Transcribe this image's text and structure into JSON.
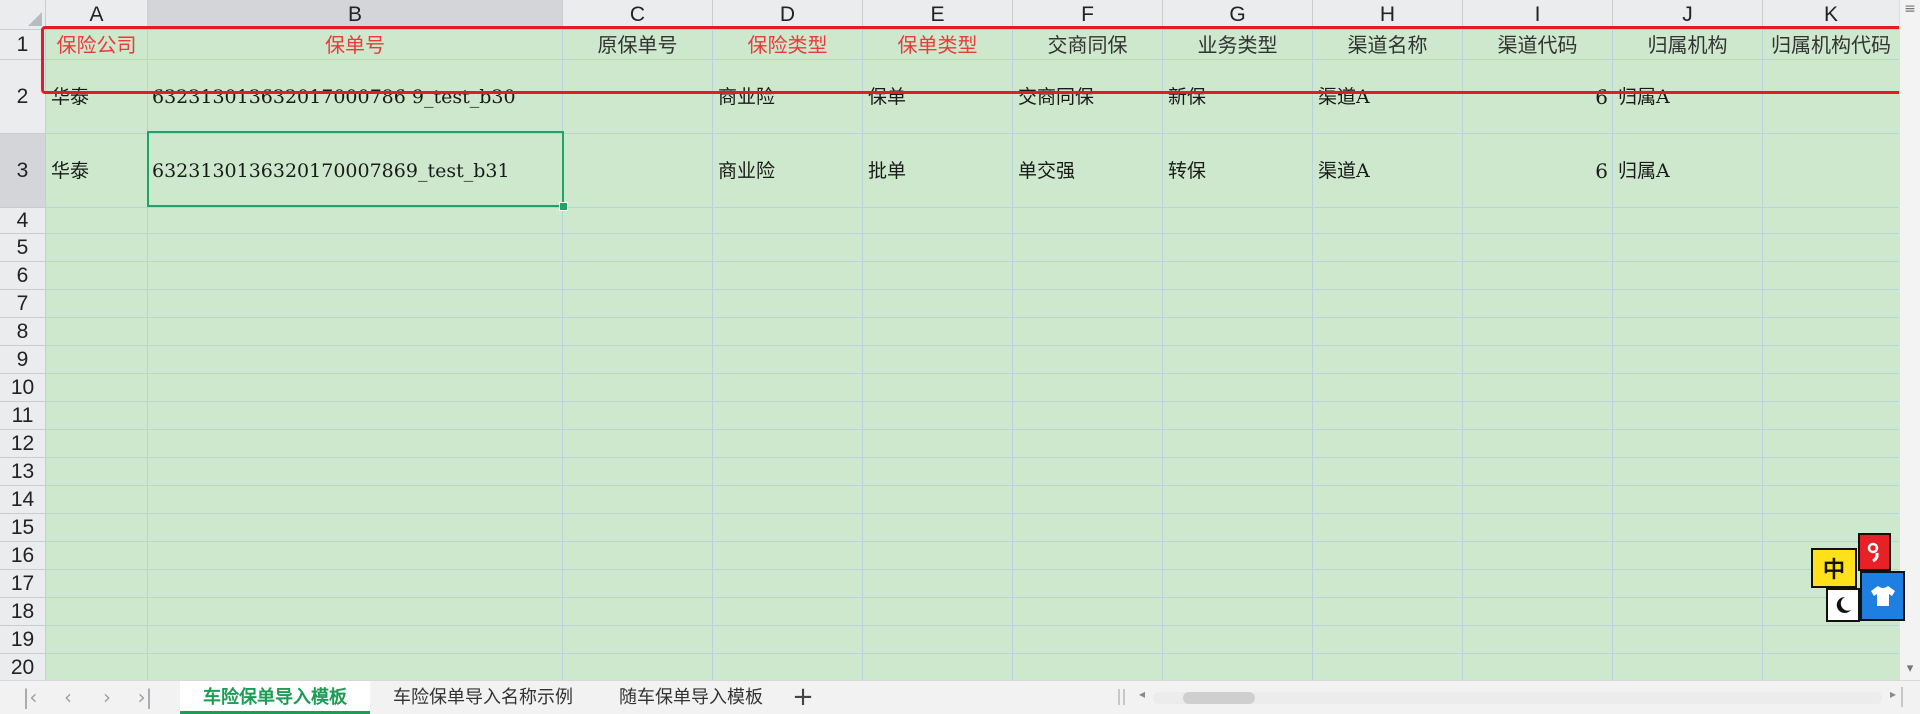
{
  "columns": [
    "A",
    "B",
    "C",
    "D",
    "E",
    "F",
    "G",
    "H",
    "I",
    "J",
    "K"
  ],
  "rows": [
    "1",
    "2",
    "3",
    "4",
    "5",
    "6",
    "7",
    "8",
    "9",
    "10",
    "11",
    "12",
    "13",
    "14",
    "15",
    "16",
    "17",
    "18",
    "19",
    "20"
  ],
  "header_cells": [
    "保险公司",
    "保单号",
    "原保单号",
    "保险类型",
    "保单类型",
    "交商同保",
    "业务类型",
    "渠道名称",
    "渠道代码",
    "归属机构",
    "归属机构代码"
  ],
  "data_rows": [
    [
      "华泰",
      "632313013632017000786 9_test_b30",
      "",
      "商业险",
      "保单",
      "交商同保",
      "新保",
      "渠道A",
      "6",
      "归属A",
      ""
    ],
    [
      "华泰",
      "6323130136320170007869_test_b31",
      "",
      "商业险",
      "批单",
      "单交强",
      "转保",
      "渠道A",
      "6",
      "归属A",
      ""
    ]
  ],
  "sheets": [
    "车险保单导入模板",
    "车险保单导入名称示例",
    "随车保单导入模板"
  ],
  "colors": {
    "required_header": "#ea3a3a",
    "cell_fill": "#cde8cd",
    "selection": "#21a366",
    "highlight": "#e31c23",
    "active_tab": "#1e9c56"
  },
  "ime": {
    "lang_label": "中"
  },
  "icons": [
    "corner-triangle-icon",
    "first-sheet-icon",
    "prev-sheet-icon",
    "next-sheet-icon",
    "last-sheet-icon",
    "add-sheet-icon",
    "scroll-left-icon",
    "scroll-right-icon",
    "scroll-up-icon",
    "scroll-down-icon",
    "ime-punctuation-icon",
    "ime-moon-icon",
    "ime-shirt-icon"
  ]
}
